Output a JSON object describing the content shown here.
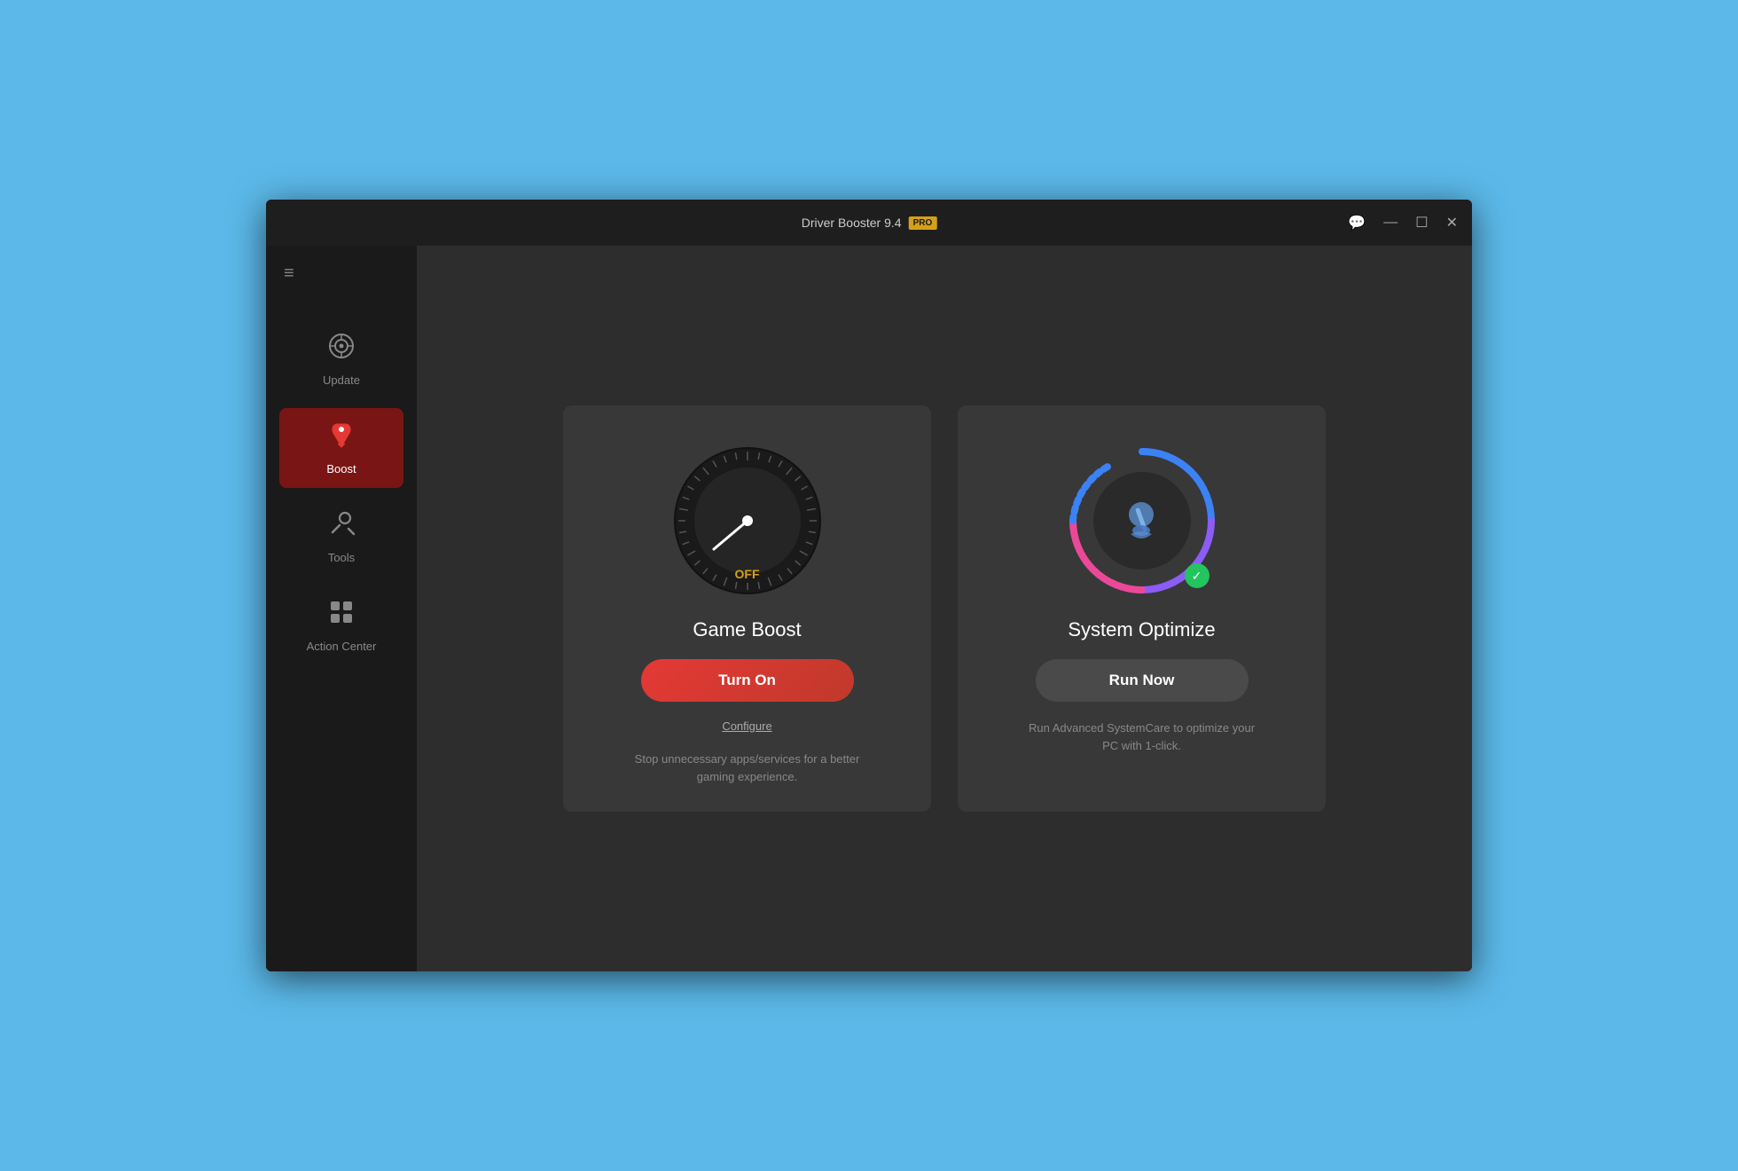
{
  "window": {
    "title": "Driver Booster 9.4",
    "badge": "PRO"
  },
  "titlebar": {
    "chat_icon": "💬",
    "minimize_icon": "—",
    "maximize_icon": "☐",
    "close_icon": "✕"
  },
  "sidebar": {
    "hamburger": "≡",
    "items": [
      {
        "id": "update",
        "label": "Update",
        "icon": "⚙",
        "active": false
      },
      {
        "id": "boost",
        "label": "Boost",
        "icon": "🚀",
        "active": true
      },
      {
        "id": "tools",
        "label": "Tools",
        "icon": "✕",
        "active": false
      },
      {
        "id": "action-center",
        "label": "Action Center",
        "icon": "⊞",
        "active": false
      }
    ]
  },
  "game_boost": {
    "title": "Game Boost",
    "status": "OFF",
    "button_label": "Turn On",
    "configure_label": "Configure",
    "description": "Stop unnecessary apps/services for a better gaming experience."
  },
  "system_optimize": {
    "title": "System Optimize",
    "button_label": "Run Now",
    "description": "Run Advanced SystemCare to optimize your PC with 1-click."
  }
}
